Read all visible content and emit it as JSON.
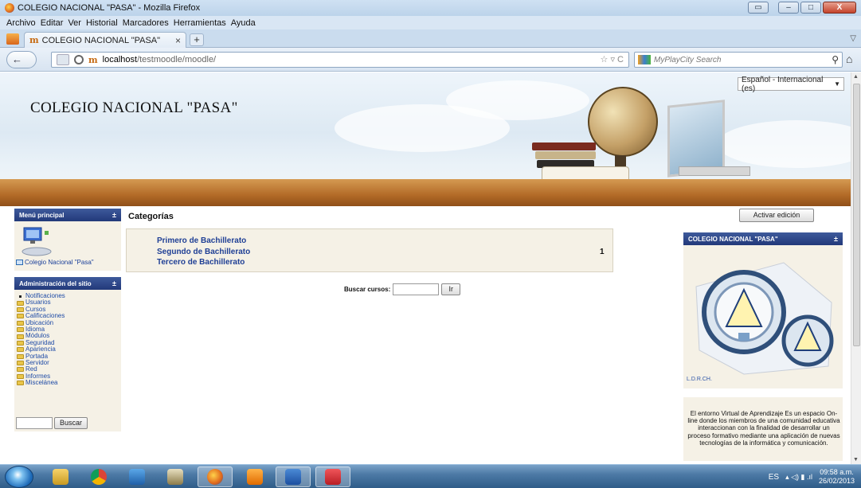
{
  "window": {
    "title": "COLEGIO NACIONAL \"PASA\" - Mozilla Firefox",
    "buttons": {
      "minimize": "–",
      "maximize": "□",
      "close": "X"
    }
  },
  "menubar": [
    "Archivo",
    "Editar",
    "Ver",
    "Historial",
    "Marcadores",
    "Herramientas",
    "Ayuda"
  ],
  "tab": {
    "label": "COLEGIO NACIONAL \"PASA\"",
    "close": "×",
    "new_tab": "+"
  },
  "navbar": {
    "back_icon": "←",
    "url_host": "localhost",
    "url_path": "/testmoodle/moodle/",
    "url_right_icons": "☆ ▿ C",
    "search_placeholder": "MyPlayCity Search",
    "search_icon": "⚲",
    "home_icon": "⌂",
    "favicon_text": "m"
  },
  "page": {
    "site_name": "COLEGIO NACIONAL \"PASA\"",
    "language_select": "Español - Internacional (es)",
    "main_menu": {
      "title": "Menú principal",
      "toggle": "±",
      "course_link": "Colegio Nacional \"Pasa\""
    },
    "admin": {
      "title": "Administración del sitio",
      "toggle": "±",
      "items": [
        {
          "label": "Notificaciones",
          "kind": "bullet"
        },
        {
          "label": "Usuarios",
          "kind": "folder"
        },
        {
          "label": "Cursos",
          "kind": "folder"
        },
        {
          "label": "Calificaciones",
          "kind": "folder"
        },
        {
          "label": "Ubicación",
          "kind": "folder"
        },
        {
          "label": "Idioma",
          "kind": "folder"
        },
        {
          "label": "Módulos",
          "kind": "folder"
        },
        {
          "label": "Seguridad",
          "kind": "folder"
        },
        {
          "label": "Apariencia",
          "kind": "folder"
        },
        {
          "label": "Portada",
          "kind": "folder"
        },
        {
          "label": "Servidor",
          "kind": "folder"
        },
        {
          "label": "Red",
          "kind": "folder"
        },
        {
          "label": "Informes",
          "kind": "folder"
        },
        {
          "label": "Miscelánea",
          "kind": "folder"
        }
      ],
      "search_button": "Buscar"
    },
    "categories": {
      "heading": "Categorías",
      "items": [
        "Primero de Bachillerato",
        "Segundo de Bachillerato",
        "Tercero de Bachillerato"
      ],
      "count": "1"
    },
    "course_search": {
      "label": "Buscar cursos:",
      "button": "Ir"
    },
    "edit_button": "Activar edición",
    "school_block": {
      "title": "COLEGIO NACIONAL \"PASA\"",
      "toggle": "±",
      "caption": "L.D.R.CH."
    },
    "info_text": "El entorno Virtual de Aprendizaje Es un espacio On-line donde los miembros de una comunidad educativa interaccionan con la finalidad de desarrollar un proceso formativo mediante una aplicación de nuevas tecnologías de la informática y comunicación."
  },
  "taskbar": {
    "apps": [
      "explorer",
      "chrome",
      "camera",
      "paint",
      "firefox",
      "media",
      "word",
      "app"
    ],
    "active_app": "firefox",
    "lang": "ES",
    "tray_icons": "▴ ◁) ▮ .ıl",
    "time": "09:58 a.m.",
    "date": "26/02/2013"
  },
  "colors": {
    "block_header": "#22397a",
    "link": "#1f3f95",
    "block_bg": "#f5f1e6",
    "shelf": "#b26a27"
  }
}
